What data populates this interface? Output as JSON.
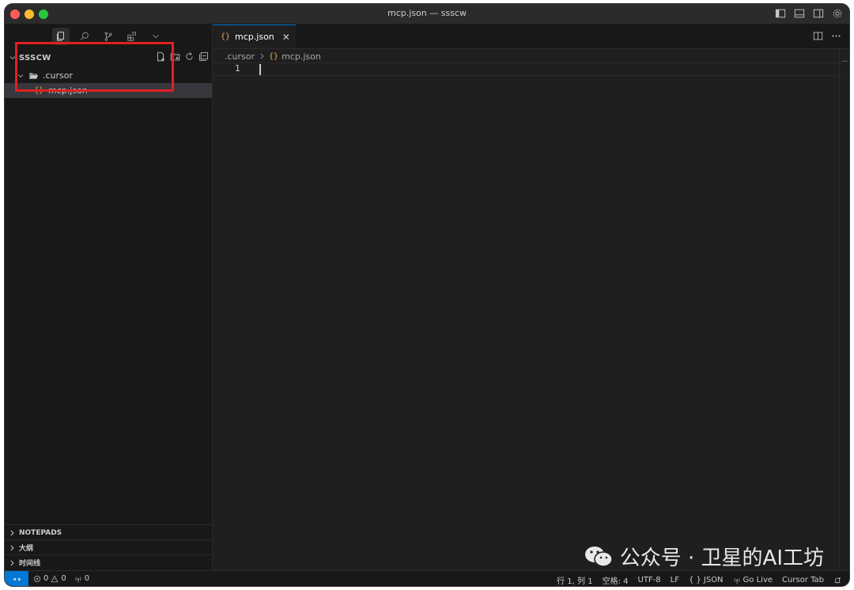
{
  "window": {
    "title": "mcp.json — ssscw"
  },
  "activity_bar": {
    "icons": [
      "files-icon",
      "search-icon",
      "source-control-icon",
      "extensions-icon",
      "chevron-down-icon"
    ]
  },
  "explorer": {
    "root": "SSSCW",
    "folder": ".cursor",
    "file": "mcp.json"
  },
  "panels": {
    "notepads": "NOTEPADS",
    "outline": "大纲",
    "timeline": "时间线"
  },
  "editor": {
    "tab_label": "mcp.json",
    "breadcrumb_folder": ".cursor",
    "breadcrumb_file": "mcp.json",
    "line_number": "1",
    "file_icon": "{}"
  },
  "statusbar": {
    "errors": "0",
    "warnings": "0",
    "ports": "0",
    "position": "行 1, 列 1",
    "indent": "空格: 4",
    "encoding": "UTF-8",
    "eol": "LF",
    "language": "JSON",
    "go_live": "Go Live",
    "cursor_tab": "Cursor Tab"
  },
  "watermark": {
    "text": "公众号 · 卫星的AI工坊"
  },
  "colors": {
    "accent": "#0078d4",
    "highlight": "#e02020",
    "json_icon": "#e8ab53"
  }
}
